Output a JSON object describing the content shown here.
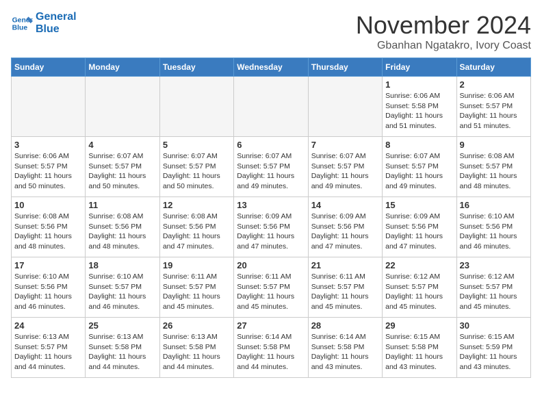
{
  "header": {
    "logo_line1": "General",
    "logo_line2": "Blue",
    "month_title": "November 2024",
    "location": "Gbanhan Ngatakro, Ivory Coast"
  },
  "days_of_week": [
    "Sunday",
    "Monday",
    "Tuesday",
    "Wednesday",
    "Thursday",
    "Friday",
    "Saturday"
  ],
  "weeks": [
    [
      {
        "day": "",
        "empty": true
      },
      {
        "day": "",
        "empty": true
      },
      {
        "day": "",
        "empty": true
      },
      {
        "day": "",
        "empty": true
      },
      {
        "day": "",
        "empty": true
      },
      {
        "day": "1",
        "sunrise": "6:06 AM",
        "sunset": "5:58 PM",
        "daylight": "11 hours and 51 minutes."
      },
      {
        "day": "2",
        "sunrise": "6:06 AM",
        "sunset": "5:57 PM",
        "daylight": "11 hours and 51 minutes."
      }
    ],
    [
      {
        "day": "3",
        "sunrise": "6:06 AM",
        "sunset": "5:57 PM",
        "daylight": "11 hours and 50 minutes."
      },
      {
        "day": "4",
        "sunrise": "6:07 AM",
        "sunset": "5:57 PM",
        "daylight": "11 hours and 50 minutes."
      },
      {
        "day": "5",
        "sunrise": "6:07 AM",
        "sunset": "5:57 PM",
        "daylight": "11 hours and 50 minutes."
      },
      {
        "day": "6",
        "sunrise": "6:07 AM",
        "sunset": "5:57 PM",
        "daylight": "11 hours and 49 minutes."
      },
      {
        "day": "7",
        "sunrise": "6:07 AM",
        "sunset": "5:57 PM",
        "daylight": "11 hours and 49 minutes."
      },
      {
        "day": "8",
        "sunrise": "6:07 AM",
        "sunset": "5:57 PM",
        "daylight": "11 hours and 49 minutes."
      },
      {
        "day": "9",
        "sunrise": "6:08 AM",
        "sunset": "5:57 PM",
        "daylight": "11 hours and 48 minutes."
      }
    ],
    [
      {
        "day": "10",
        "sunrise": "6:08 AM",
        "sunset": "5:56 PM",
        "daylight": "11 hours and 48 minutes."
      },
      {
        "day": "11",
        "sunrise": "6:08 AM",
        "sunset": "5:56 PM",
        "daylight": "11 hours and 48 minutes."
      },
      {
        "day": "12",
        "sunrise": "6:08 AM",
        "sunset": "5:56 PM",
        "daylight": "11 hours and 47 minutes."
      },
      {
        "day": "13",
        "sunrise": "6:09 AM",
        "sunset": "5:56 PM",
        "daylight": "11 hours and 47 minutes."
      },
      {
        "day": "14",
        "sunrise": "6:09 AM",
        "sunset": "5:56 PM",
        "daylight": "11 hours and 47 minutes."
      },
      {
        "day": "15",
        "sunrise": "6:09 AM",
        "sunset": "5:56 PM",
        "daylight": "11 hours and 47 minutes."
      },
      {
        "day": "16",
        "sunrise": "6:10 AM",
        "sunset": "5:56 PM",
        "daylight": "11 hours and 46 minutes."
      }
    ],
    [
      {
        "day": "17",
        "sunrise": "6:10 AM",
        "sunset": "5:56 PM",
        "daylight": "11 hours and 46 minutes."
      },
      {
        "day": "18",
        "sunrise": "6:10 AM",
        "sunset": "5:57 PM",
        "daylight": "11 hours and 46 minutes."
      },
      {
        "day": "19",
        "sunrise": "6:11 AM",
        "sunset": "5:57 PM",
        "daylight": "11 hours and 45 minutes."
      },
      {
        "day": "20",
        "sunrise": "6:11 AM",
        "sunset": "5:57 PM",
        "daylight": "11 hours and 45 minutes."
      },
      {
        "day": "21",
        "sunrise": "6:11 AM",
        "sunset": "5:57 PM",
        "daylight": "11 hours and 45 minutes."
      },
      {
        "day": "22",
        "sunrise": "6:12 AM",
        "sunset": "5:57 PM",
        "daylight": "11 hours and 45 minutes."
      },
      {
        "day": "23",
        "sunrise": "6:12 AM",
        "sunset": "5:57 PM",
        "daylight": "11 hours and 45 minutes."
      }
    ],
    [
      {
        "day": "24",
        "sunrise": "6:13 AM",
        "sunset": "5:57 PM",
        "daylight": "11 hours and 44 minutes."
      },
      {
        "day": "25",
        "sunrise": "6:13 AM",
        "sunset": "5:58 PM",
        "daylight": "11 hours and 44 minutes."
      },
      {
        "day": "26",
        "sunrise": "6:13 AM",
        "sunset": "5:58 PM",
        "daylight": "11 hours and 44 minutes."
      },
      {
        "day": "27",
        "sunrise": "6:14 AM",
        "sunset": "5:58 PM",
        "daylight": "11 hours and 44 minutes."
      },
      {
        "day": "28",
        "sunrise": "6:14 AM",
        "sunset": "5:58 PM",
        "daylight": "11 hours and 43 minutes."
      },
      {
        "day": "29",
        "sunrise": "6:15 AM",
        "sunset": "5:58 PM",
        "daylight": "11 hours and 43 minutes."
      },
      {
        "day": "30",
        "sunrise": "6:15 AM",
        "sunset": "5:59 PM",
        "daylight": "11 hours and 43 minutes."
      }
    ]
  ]
}
